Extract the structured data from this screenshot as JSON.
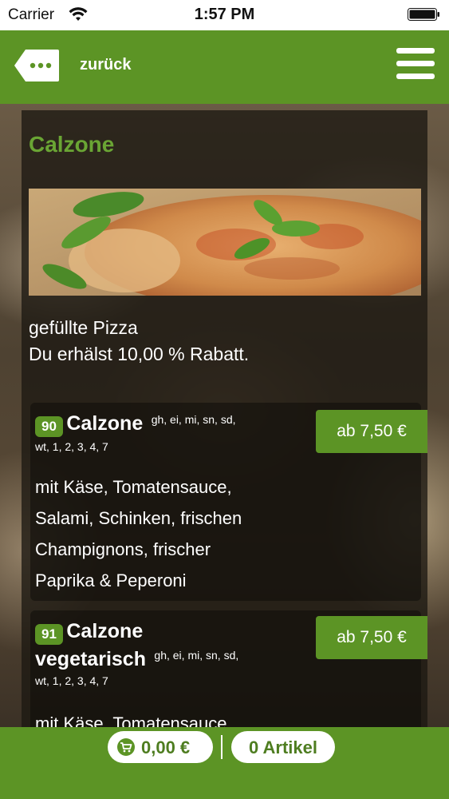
{
  "status_bar": {
    "carrier": "Carrier",
    "time": "1:57 PM"
  },
  "nav": {
    "back_label": "zurück",
    "back_icon": "speech-bubble-back-icon",
    "menu_icon": "hamburger-menu-icon"
  },
  "category": {
    "title": "Calzone",
    "description_line1": "gefüllte Pizza",
    "description_line2": "Du erhälst 10,00 % Rabatt."
  },
  "items": [
    {
      "number": "90",
      "name": "Calzone",
      "allergens_line1": "gh, ei, mi, sn, sd,",
      "allergens_line2": "wt, 1, 2, 3, 4, 7",
      "price": "ab 7,50 €",
      "desc_line1": "mit Käse, Tomatensauce,",
      "desc_line2": "Salami, Schinken, frischen",
      "desc_line3": "Champignons, frischer",
      "desc_line4": "Paprika & Peperoni"
    },
    {
      "number": "91",
      "name_line1": "Calzone",
      "name_line2": "vegetarisch",
      "allergens_line1": "gh, ei, mi, sn, sd,",
      "allergens_line2": "wt, 1, 2, 3, 4, 7",
      "price": "ab 7,50 €",
      "desc_line1": "mit Käse, Tomatensauce,"
    }
  ],
  "cart": {
    "total": "0,00 €",
    "articles": "0 Artikel",
    "icon": "shopping-cart-icon"
  },
  "colors": {
    "brand_green": "#5c9425",
    "title_green": "#6aa534"
  }
}
